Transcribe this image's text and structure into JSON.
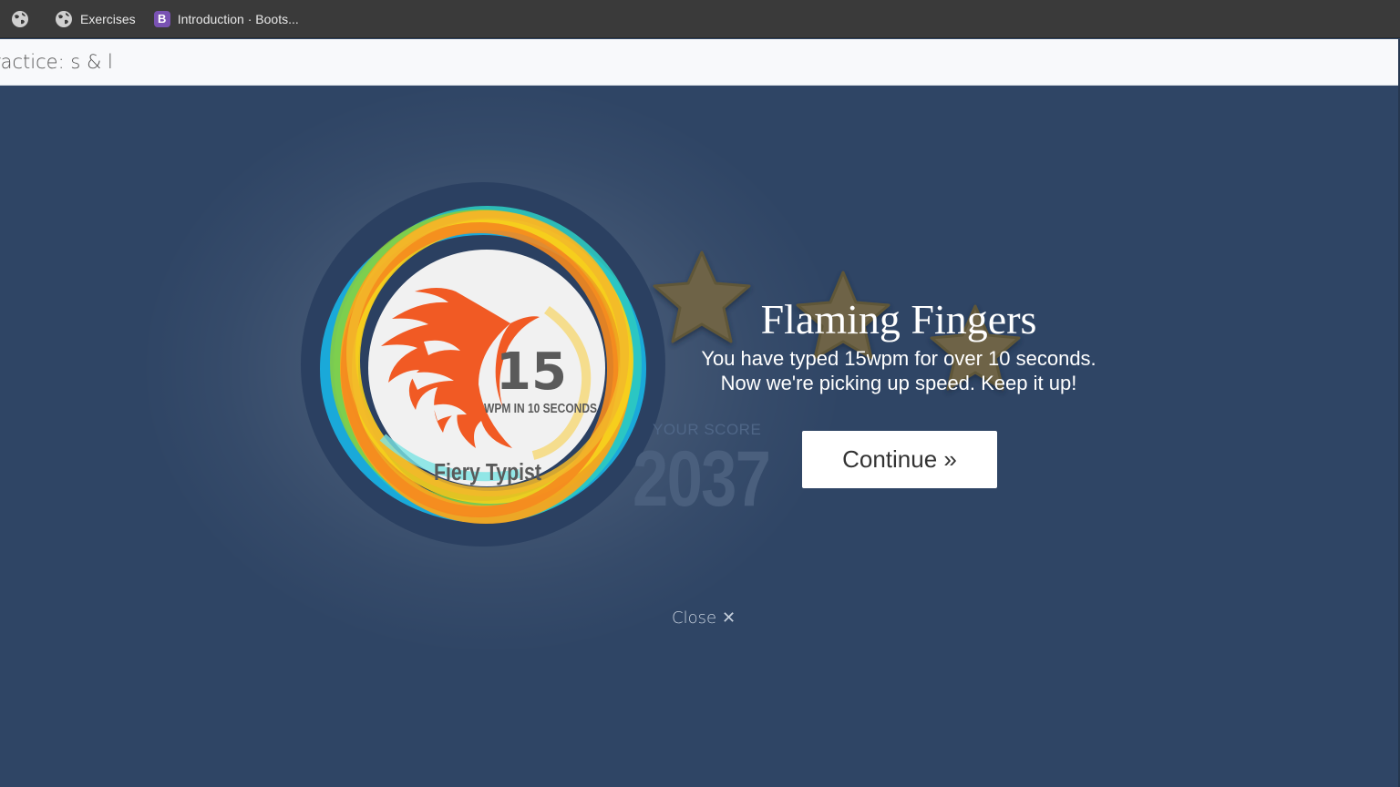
{
  "bookmarks": [
    {
      "label": "",
      "icon": "globe-icon"
    },
    {
      "label": "Exercises",
      "icon": "globe-icon"
    },
    {
      "label": "Introduction · Boots...",
      "icon": "bootstrap-icon",
      "icon_letter": "B"
    }
  ],
  "lesson": {
    "title": "ractice: s & l"
  },
  "badge": {
    "number": "15",
    "subtitle": "WPM IN 10 SECONDS",
    "name": "Fiery Typist"
  },
  "score": {
    "label": "YOUR SCORE",
    "value": "2037"
  },
  "achievement": {
    "title": "Flaming Fingers",
    "line1": "You have typed 15wpm for over 10 seconds.",
    "line2": "Now we're picking up speed. Keep it up!"
  },
  "buttons": {
    "continue": "Continue »",
    "close": "Close",
    "close_icon": "✕"
  },
  "colors": {
    "overlay_bg": "#2f4565",
    "flame": "#f15a24",
    "star": "#6e6446",
    "button_bg": "#ffffff"
  }
}
